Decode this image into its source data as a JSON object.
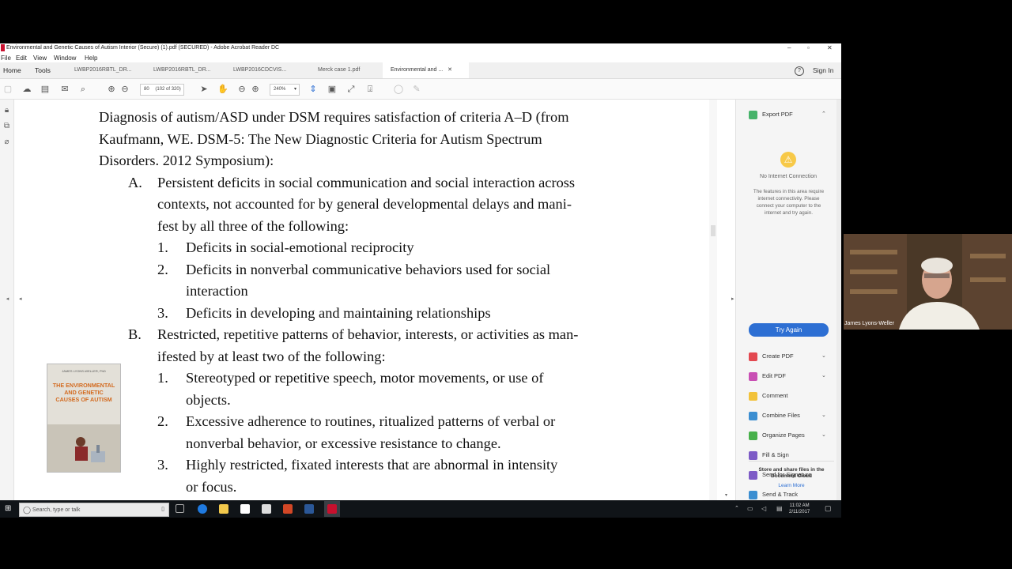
{
  "window": {
    "title": "Environmental and Genetic Causes of Autism Interior (Secure) (1).pdf (SECURED) - Adobe Acrobat Reader DC",
    "min": "–",
    "max": "▫",
    "close": "✕"
  },
  "menu": [
    "File",
    "Edit",
    "View",
    "Window",
    "Help"
  ],
  "tabs": {
    "home": "Home",
    "tools": "Tools",
    "docs": [
      "LWBP2016RBTL_DR...",
      "LWBP2016RBTL_DR...",
      "LWBP2016CDCVIS...",
      "Merck case 1.pdf",
      "Environmental and ..."
    ],
    "help_icon": "?",
    "sign_in": "Sign In"
  },
  "toolbar": {
    "page_value": "80",
    "page_of": "(102 of 320)",
    "zoom": "240%"
  },
  "document": {
    "lines": [
      {
        "text": "Diagnosis of autism/ASD under DSM requires satisfaction of criteria A–D (from"
      },
      {
        "text": "Kaufmann, WE. DSM-5: The New Diagnostic Criteria for Autism Spectrum"
      },
      {
        "text": "Disorders. 2012 Symposium):"
      },
      {
        "marker": "A.",
        "text": "Persistent deficits in social communication and social interaction across"
      },
      {
        "text": "contexts, not accounted for by general developmental delays and mani-"
      },
      {
        "text": "fest by all three of the following:"
      },
      {
        "marker": "1.",
        "text": "Deficits in social-emotional reciprocity"
      },
      {
        "marker": "2.",
        "text": "Deficits in nonverbal communicative behaviors used for social"
      },
      {
        "text": "interaction"
      },
      {
        "marker": "3.",
        "text": "Deficits in developing and maintaining relationships"
      },
      {
        "marker": "B.",
        "text": "Restricted, repetitive patterns of behavior, interests, or activities as man-"
      },
      {
        "text": "ifested by at least two of the following:"
      },
      {
        "marker": "1.",
        "text": "Stereotyped or repetitive speech, motor movements, or use of"
      },
      {
        "text": "objects."
      },
      {
        "marker": "2.",
        "text": "Excessive adherence to routines, ritualized patterns of verbal or"
      },
      {
        "text": "nonverbal behavior, or excessive resistance to change."
      },
      {
        "marker": "3.",
        "text": "Highly restricted, fixated interests that are abnormal in intensity"
      },
      {
        "text": "or focus."
      }
    ]
  },
  "book_cover": {
    "author": "JAMES LYONS-WELLER, PhD",
    "title": "THE ENVIRONMENTAL AND GENETIC CAUSES OF AUTISM"
  },
  "right_panel": {
    "export_pdf": "Export PDF",
    "no_internet_title": "No Internet Connection",
    "no_internet_msg": "The features in this area require internet connectivity. Please connect your computer to the internet and try again.",
    "try_again": "Try Again",
    "tools": [
      {
        "label": "Create PDF",
        "color": "#e34850",
        "dropdown": true
      },
      {
        "label": "Edit PDF",
        "color": "#c94fb4",
        "dropdown": true
      },
      {
        "label": "Comment",
        "color": "#f2c23a",
        "dropdown": false
      },
      {
        "label": "Combine Files",
        "color": "#3b8ed1",
        "dropdown": true
      },
      {
        "label": "Organize Pages",
        "color": "#47b04a",
        "dropdown": true
      },
      {
        "label": "Fill & Sign",
        "color": "#7d5bc6",
        "dropdown": false
      },
      {
        "label": "Send for Signature",
        "color": "#7d5bc6",
        "dropdown": false
      },
      {
        "label": "Send & Track",
        "color": "#3b8ed1",
        "dropdown": false
      }
    ],
    "store_msg": "Store and share files in the Document Cloud",
    "learn_more": "Learn More"
  },
  "webcam": {
    "name": "James Lyons-Weller"
  },
  "taskbar": {
    "search_placeholder": "Search, type or talk",
    "time": "11:02 AM",
    "date": "2/11/2017"
  }
}
